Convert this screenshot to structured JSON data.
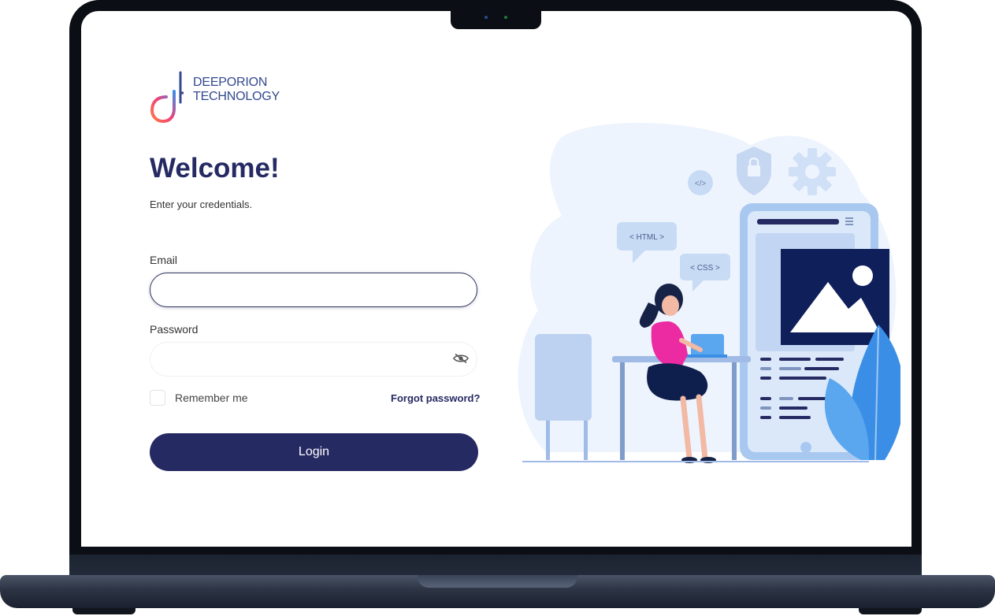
{
  "brand": {
    "line1": "DEEPORION",
    "line2": "TECHNOLOGY",
    "colors": {
      "primary": "#262a63",
      "logo_text": "#33498f",
      "logo_gradient": [
        "#ff6b4a",
        "#f0407a",
        "#3a8ee8"
      ]
    }
  },
  "login": {
    "title": "Welcome!",
    "subtitle": "Enter your credentials.",
    "email": {
      "label": "Email",
      "value": "",
      "placeholder": ""
    },
    "password": {
      "label": "Password",
      "value": "",
      "placeholder": ""
    },
    "remember_label": "Remember me",
    "remember_checked": false,
    "forgot_label": "Forgot password?",
    "submit_label": "Login"
  },
  "illustration": {
    "html_bubble": "< HTML >",
    "css_bubble": "< CSS >",
    "code_badge": "</>"
  },
  "icons": [
    "password-visibility-icon",
    "shield-lock-icon",
    "gear-icon",
    "image-icon",
    "code-icon"
  ]
}
